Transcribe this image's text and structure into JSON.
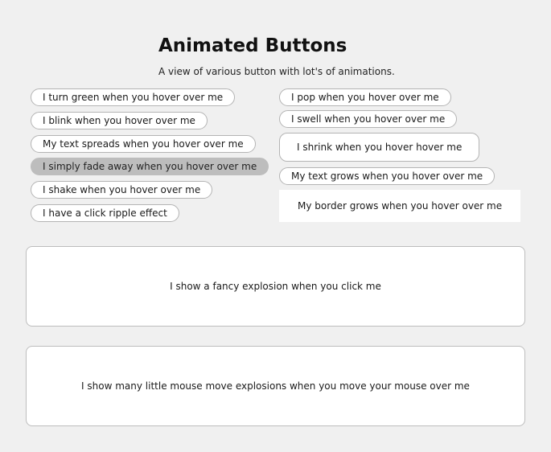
{
  "header": {
    "title": "Animated Buttons",
    "subtitle": "A view of various button with lot's of animations."
  },
  "left_buttons": [
    {
      "label": "I turn green when you hover over me"
    },
    {
      "label": "I blink when you hover over me"
    },
    {
      "label": "My text spreads when you hover over me"
    },
    {
      "label": "I simply fade away when you hover over me"
    },
    {
      "label": "I shake when you hover over me"
    },
    {
      "label": "I have a click ripple effect"
    }
  ],
  "right_buttons": [
    {
      "label": "I pop when you hover over me"
    },
    {
      "label": "I swell when you hover over me"
    },
    {
      "label": "I shrink when you hover hover me"
    },
    {
      "label": "My text grows when you hover over me"
    },
    {
      "label": "My border grows when you hover over me"
    }
  ],
  "explosion_button": {
    "label": "I show a fancy explosion when you click me"
  },
  "mouse_move_area": {
    "label": "I show many little mouse move explosions when you move your mouse over me"
  }
}
